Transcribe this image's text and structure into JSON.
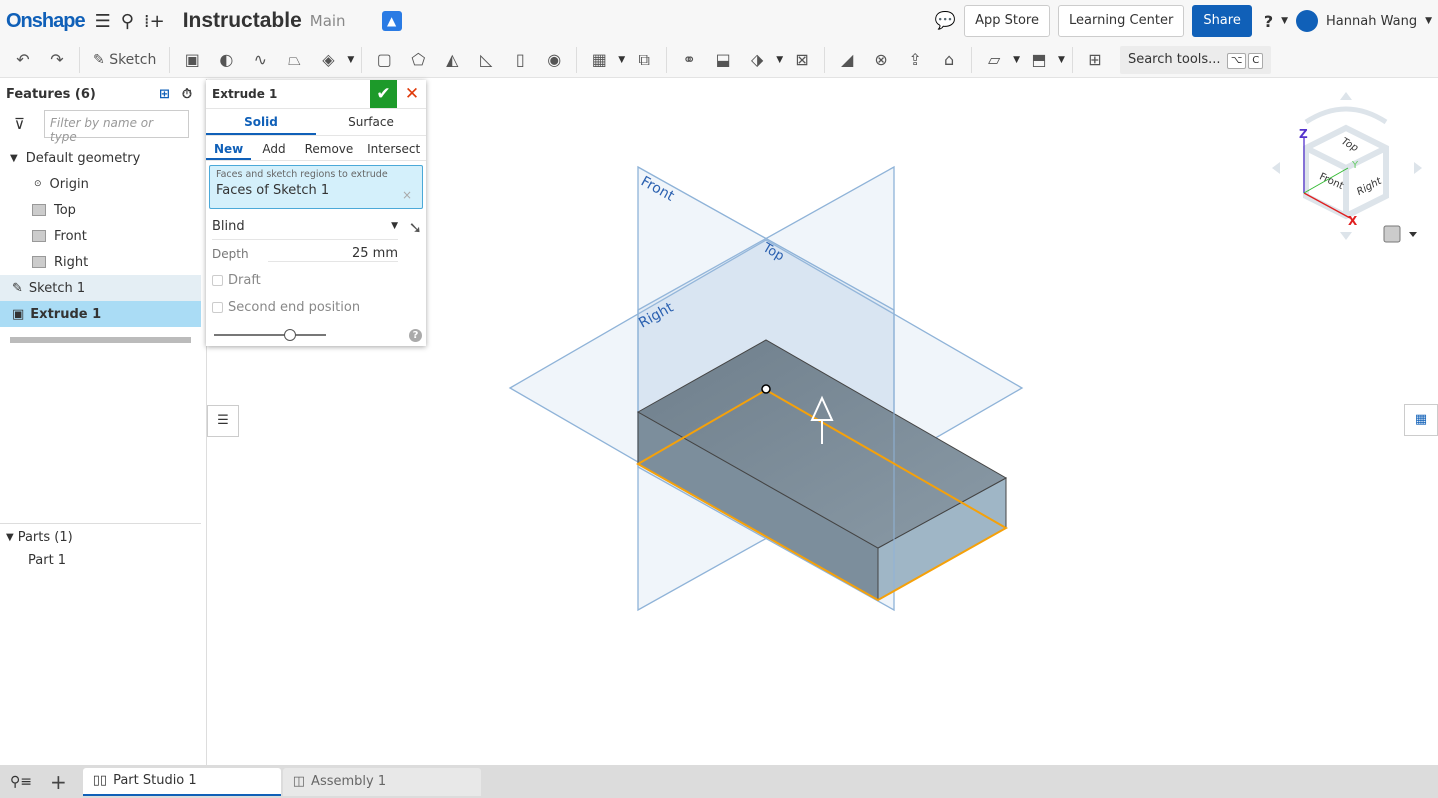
{
  "header": {
    "logo": "Onshape",
    "doc_title": "Instructable",
    "branch": "Main",
    "app_store": "App Store",
    "learning_center": "Learning Center",
    "share": "Share",
    "help": "?",
    "user": "Hannah Wang"
  },
  "toolbar": {
    "sketch": "Sketch",
    "search": "Search tools...",
    "kbd1": "⌥",
    "kbd2": "C"
  },
  "features": {
    "title": "Features (6)",
    "filter_placeholder": "Filter by name or type",
    "items": [
      {
        "label": "Default geometry"
      },
      {
        "label": "Origin"
      },
      {
        "label": "Top"
      },
      {
        "label": "Front"
      },
      {
        "label": "Right"
      },
      {
        "label": "Sketch 1"
      },
      {
        "label": "Extrude 1"
      }
    ]
  },
  "parts": {
    "title": "Parts (1)",
    "items": [
      {
        "label": "Part 1"
      }
    ]
  },
  "dialog": {
    "title": "Extrude 1",
    "tabs": [
      "Solid",
      "Surface"
    ],
    "ops": [
      "New",
      "Add",
      "Remove",
      "Intersect"
    ],
    "sel_label": "Faces and sketch regions to extrude",
    "sel_value": "Faces of Sketch 1",
    "end_type": "Blind",
    "depth_label": "Depth",
    "depth_value": "25 mm",
    "draft": "Draft",
    "second_end": "Second end position"
  },
  "viewport": {
    "planes": {
      "front": "Front",
      "top": "Top",
      "right": "Right"
    },
    "cube": {
      "top": "Top",
      "front": "Front",
      "right": "Right",
      "x": "X",
      "y": "Y",
      "z": "Z"
    }
  },
  "tabs": [
    {
      "label": "Part Studio 1",
      "active": true
    },
    {
      "label": "Assembly 1",
      "active": false
    }
  ],
  "colors": {
    "brand": "#1060b8",
    "accept": "#1d9a2a",
    "cancel": "#e03a0a",
    "selection": "#f5a10a"
  }
}
